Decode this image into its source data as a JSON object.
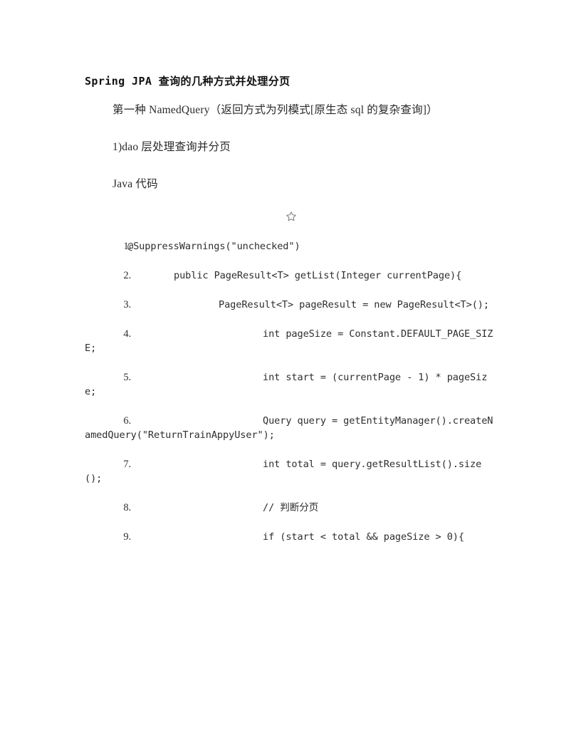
{
  "document": {
    "title": "Spring JPA 查询的几种方式并处理分页",
    "paragraphs": [
      "第一种 NamedQuery（返回方式为列模式[原生态 sql 的复杂查询]）",
      "1)dao 层处理查询并分页",
      "Java 代码"
    ],
    "toolbar": {
      "favorite_icon": "star-icon"
    },
    "code_block": {
      "language": "Java",
      "lines": [
        {
          "number": "1.",
          "indent": "ind-0",
          "text": "@SuppressWarnings(\"unchecked\")"
        },
        {
          "number": "2.",
          "indent": "ind-1",
          "text": "public PageResult<T> getList(Integer currentPage){"
        },
        {
          "number": "3.",
          "indent": "ind-2",
          "text": "PageResult<T> pageResult = new PageResult<T>();"
        },
        {
          "number": "4.",
          "indent": "ind-3",
          "text": "int pageSize = Constant.DEFAULT_PAGE_SIZE;"
        },
        {
          "number": "5.",
          "indent": "ind-3",
          "text": "int start = (currentPage - 1) * pageSize;"
        },
        {
          "number": "6.",
          "indent": "ind-3",
          "text": "Query query = getEntityManager().createNamedQuery(\"ReturnTrainAppyUser\");"
        },
        {
          "number": "7.",
          "indent": "ind-3",
          "text": "int total = query.getResultList().size();"
        },
        {
          "number": "8.",
          "indent": "ind-3",
          "text": "// 判断分页"
        },
        {
          "number": "9.",
          "indent": "ind-3",
          "text": "if (start < total && pageSize > 0){"
        }
      ]
    },
    "colors": {
      "background": "#ffffff",
      "text": "#2b2b2b",
      "title": "#111111",
      "icon": "#8a8a8a"
    }
  }
}
